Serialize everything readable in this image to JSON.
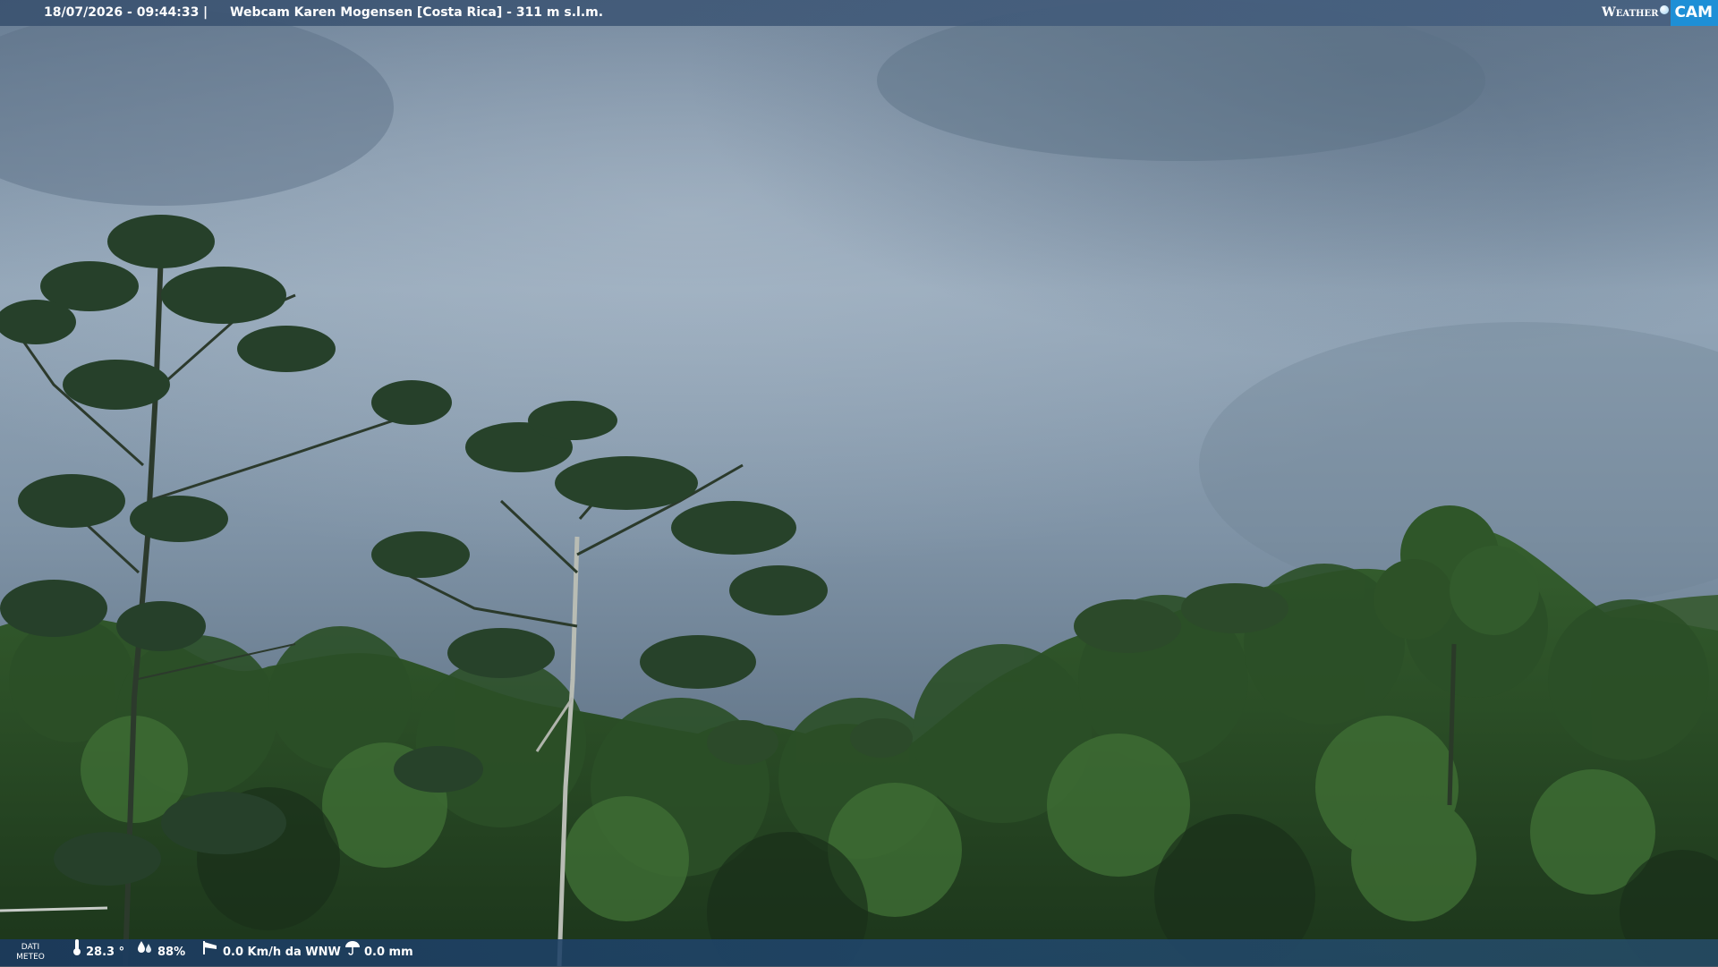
{
  "header": {
    "datetime": "18/07/2026 - 09:44:33",
    "separator": "|",
    "camera_title": "Webcam Karen Mogensen [Costa Rica] - 311 m s.l.m."
  },
  "logo": {
    "weather_text": "Weather",
    "cam_text": "CAM",
    "accent_color": "#1e8fd6"
  },
  "meteo": {
    "label_line1": "DATI",
    "label_line2": "METEO",
    "temperature": "28.3 °",
    "humidity": "88%",
    "wind": "0.0 Km/h da WNW",
    "rain": "0.0 mm",
    "icons": {
      "temperature": "thermometer-icon",
      "humidity": "humidity-drops-icon",
      "wind": "windsock-icon",
      "rain": "rain-umbrella-icon"
    }
  },
  "colors": {
    "sky_top": "#6a7f95",
    "sky_mid": "#9aabbb",
    "sky_low": "#5f7284",
    "forest_dark": "#1e3a1e",
    "forest_mid": "#2f5a2a",
    "forest_light": "#4a7a3a"
  }
}
